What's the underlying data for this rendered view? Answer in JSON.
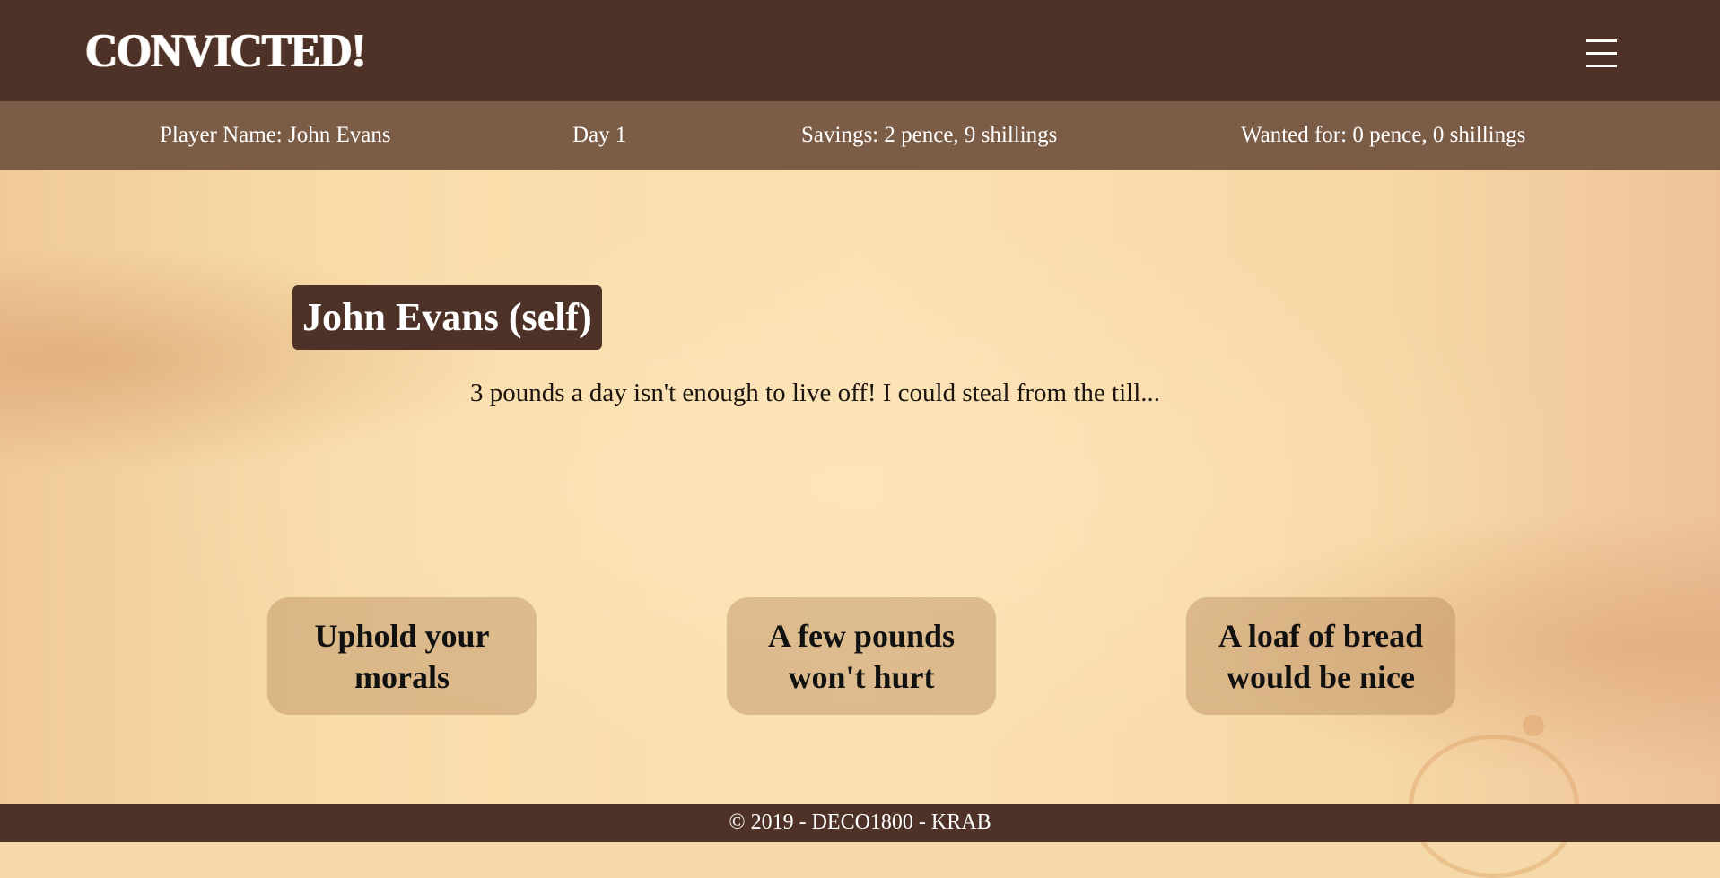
{
  "header": {
    "logo": "CONVICTED!",
    "menu_icon": "hamburger-menu-icon"
  },
  "status": {
    "player_name": "Player Name: John Evans",
    "day": "Day 1",
    "savings": "Savings: 2 pence, 9 shillings",
    "wanted": "Wanted for: 0 pence, 0 shillings"
  },
  "scene": {
    "speaker": "John Evans (self)",
    "dialogue": "3 pounds a day isn't enough to live off! I could steal from the till..."
  },
  "choices": [
    {
      "label": "Uphold your morals"
    },
    {
      "label": "A few pounds won't hurt"
    },
    {
      "label": "A loaf of bread would be nice"
    }
  ],
  "footer": {
    "text": "© 2019 - DECO1800 - KRAB"
  },
  "colors": {
    "header_bg": "#4f3227",
    "statusbar_bg": "#7b5c47",
    "speaker_bg": "#4f3227",
    "parchment": "#f8dcaa"
  }
}
